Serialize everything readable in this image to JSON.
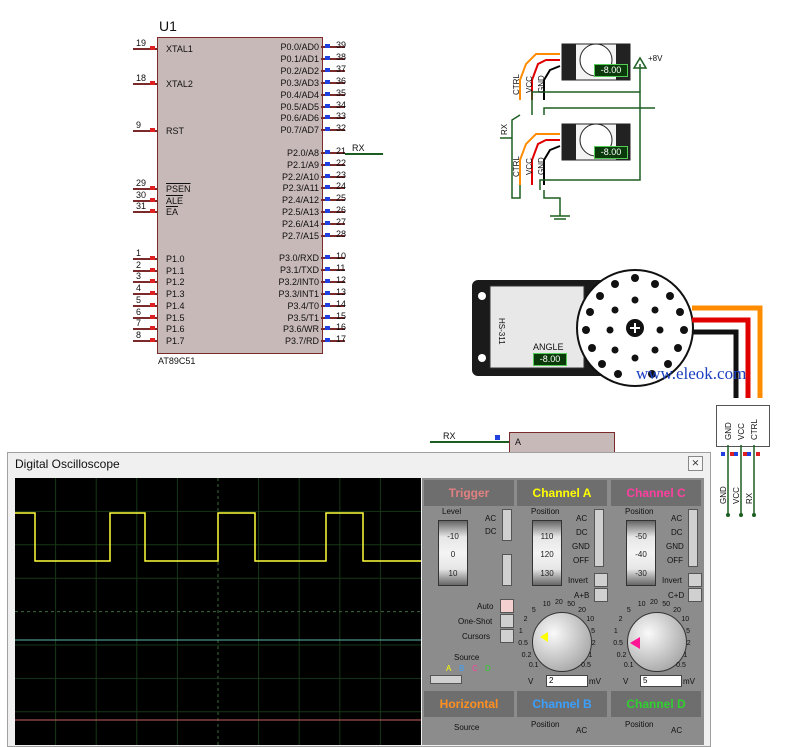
{
  "schematic": {
    "mcu": {
      "ref": "U1",
      "part": "AT89C51",
      "left_pins": [
        {
          "num": "19",
          "name": "XTAL1"
        },
        {
          "num": "18",
          "name": "XTAL2"
        },
        {
          "num": "9",
          "name": "RST"
        },
        {
          "num": "29",
          "name": "PSEN"
        },
        {
          "num": "30",
          "name": "ALE"
        },
        {
          "num": "31",
          "name": "EA"
        },
        {
          "num": "1",
          "name": "P1.0"
        },
        {
          "num": "2",
          "name": "P1.1"
        },
        {
          "num": "3",
          "name": "P1.2"
        },
        {
          "num": "4",
          "name": "P1.3"
        },
        {
          "num": "5",
          "name": "P1.4"
        },
        {
          "num": "6",
          "name": "P1.5"
        },
        {
          "num": "7",
          "name": "P1.6"
        },
        {
          "num": "8",
          "name": "P1.7"
        }
      ],
      "right_pins": [
        {
          "num": "39",
          "name": "P0.0/AD0"
        },
        {
          "num": "38",
          "name": "P0.1/AD1"
        },
        {
          "num": "37",
          "name": "P0.2/AD2"
        },
        {
          "num": "36",
          "name": "P0.3/AD3"
        },
        {
          "num": "35",
          "name": "P0.4/AD4"
        },
        {
          "num": "34",
          "name": "P0.5/AD5"
        },
        {
          "num": "33",
          "name": "P0.6/AD6"
        },
        {
          "num": "32",
          "name": "P0.7/AD7"
        },
        {
          "num": "21",
          "name": "P2.0/A8"
        },
        {
          "num": "22",
          "name": "P2.1/A9"
        },
        {
          "num": "23",
          "name": "P2.2/A10"
        },
        {
          "num": "24",
          "name": "P2.3/A11"
        },
        {
          "num": "25",
          "name": "P2.4/A12"
        },
        {
          "num": "26",
          "name": "P2.5/A13"
        },
        {
          "num": "27",
          "name": "P2.6/A14"
        },
        {
          "num": "28",
          "name": "P2.7/A15"
        },
        {
          "num": "10",
          "name": "P3.0/RXD"
        },
        {
          "num": "11",
          "name": "P3.1/TXD"
        },
        {
          "num": "12",
          "name": "P3.2/INT0"
        },
        {
          "num": "13",
          "name": "P3.3/INT1"
        },
        {
          "num": "14",
          "name": "P3.4/T0"
        },
        {
          "num": "15",
          "name": "P3.5/T1"
        },
        {
          "num": "16",
          "name": "P3.6/WR"
        },
        {
          "num": "17",
          "name": "P3.7/RD"
        }
      ],
      "net_label": "RX"
    },
    "servos_small": {
      "readout": "-8.00",
      "supply": "+8V",
      "pins": [
        "CTRL",
        "VCC",
        "GND"
      ],
      "net_label": "RX"
    },
    "servo_large": {
      "model": "HS-311",
      "angle_label": "ANGLE",
      "readout": "-8.00",
      "pins": [
        "GND",
        "VCC",
        "CTRL"
      ],
      "bottom_labels": [
        "GND",
        "VCC",
        "RX"
      ]
    },
    "watermark": "www.eleok.com",
    "scope_probe": {
      "net_label": "RX",
      "pin": "A"
    }
  },
  "oscilloscope": {
    "title": "Digital Oscilloscope",
    "trigger": {
      "header": "Trigger",
      "level_label": "Level",
      "level_ticks": [
        "-10",
        "0",
        "10"
      ],
      "ac": "AC",
      "dc": "DC",
      "modes": [
        "Auto",
        "One-Shot",
        "Cursors"
      ],
      "source_label": "Source",
      "sources": [
        "A",
        "B",
        "C",
        "D"
      ]
    },
    "channel_a": {
      "header": "Channel A",
      "position_label": "Position",
      "position_ticks": [
        "110",
        "120",
        "130"
      ],
      "coupling": [
        "AC",
        "DC",
        "GND",
        "OFF"
      ],
      "invert": "Invert",
      "combine": "A+B",
      "dial_value": "2",
      "dial_unit_v": "V",
      "dial_unit_mv": "mV"
    },
    "channel_c": {
      "header": "Channel C",
      "position_label": "Position",
      "position_ticks": [
        "-50",
        "-40",
        "-30"
      ],
      "coupling": [
        "AC",
        "DC",
        "GND",
        "OFF"
      ],
      "invert": "Invert",
      "combine": "C+D",
      "dial_value": "5",
      "dial_unit_v": "V",
      "dial_unit_mv": "mV"
    },
    "horizontal": {
      "header": "Horizontal",
      "source_label": "Source"
    },
    "channel_b": {
      "header": "Channel B",
      "position_label": "Position",
      "ac": "AC"
    },
    "channel_d": {
      "header": "Channel D",
      "position_label": "Position",
      "ac": "AC"
    },
    "dial_scale": [
      "0.1",
      "0.2",
      "0.5",
      "1",
      "2",
      "5",
      "10",
      "20",
      "50",
      "20",
      "10",
      "5",
      "2",
      "1",
      "0.5"
    ],
    "colors": {
      "trigger": "#e08080",
      "channel_a": "#ffff00",
      "channel_b": "#3aa0ff",
      "channel_c": "#ff3fa0",
      "channel_d": "#30d030",
      "horizontal": "#ff9020"
    }
  }
}
